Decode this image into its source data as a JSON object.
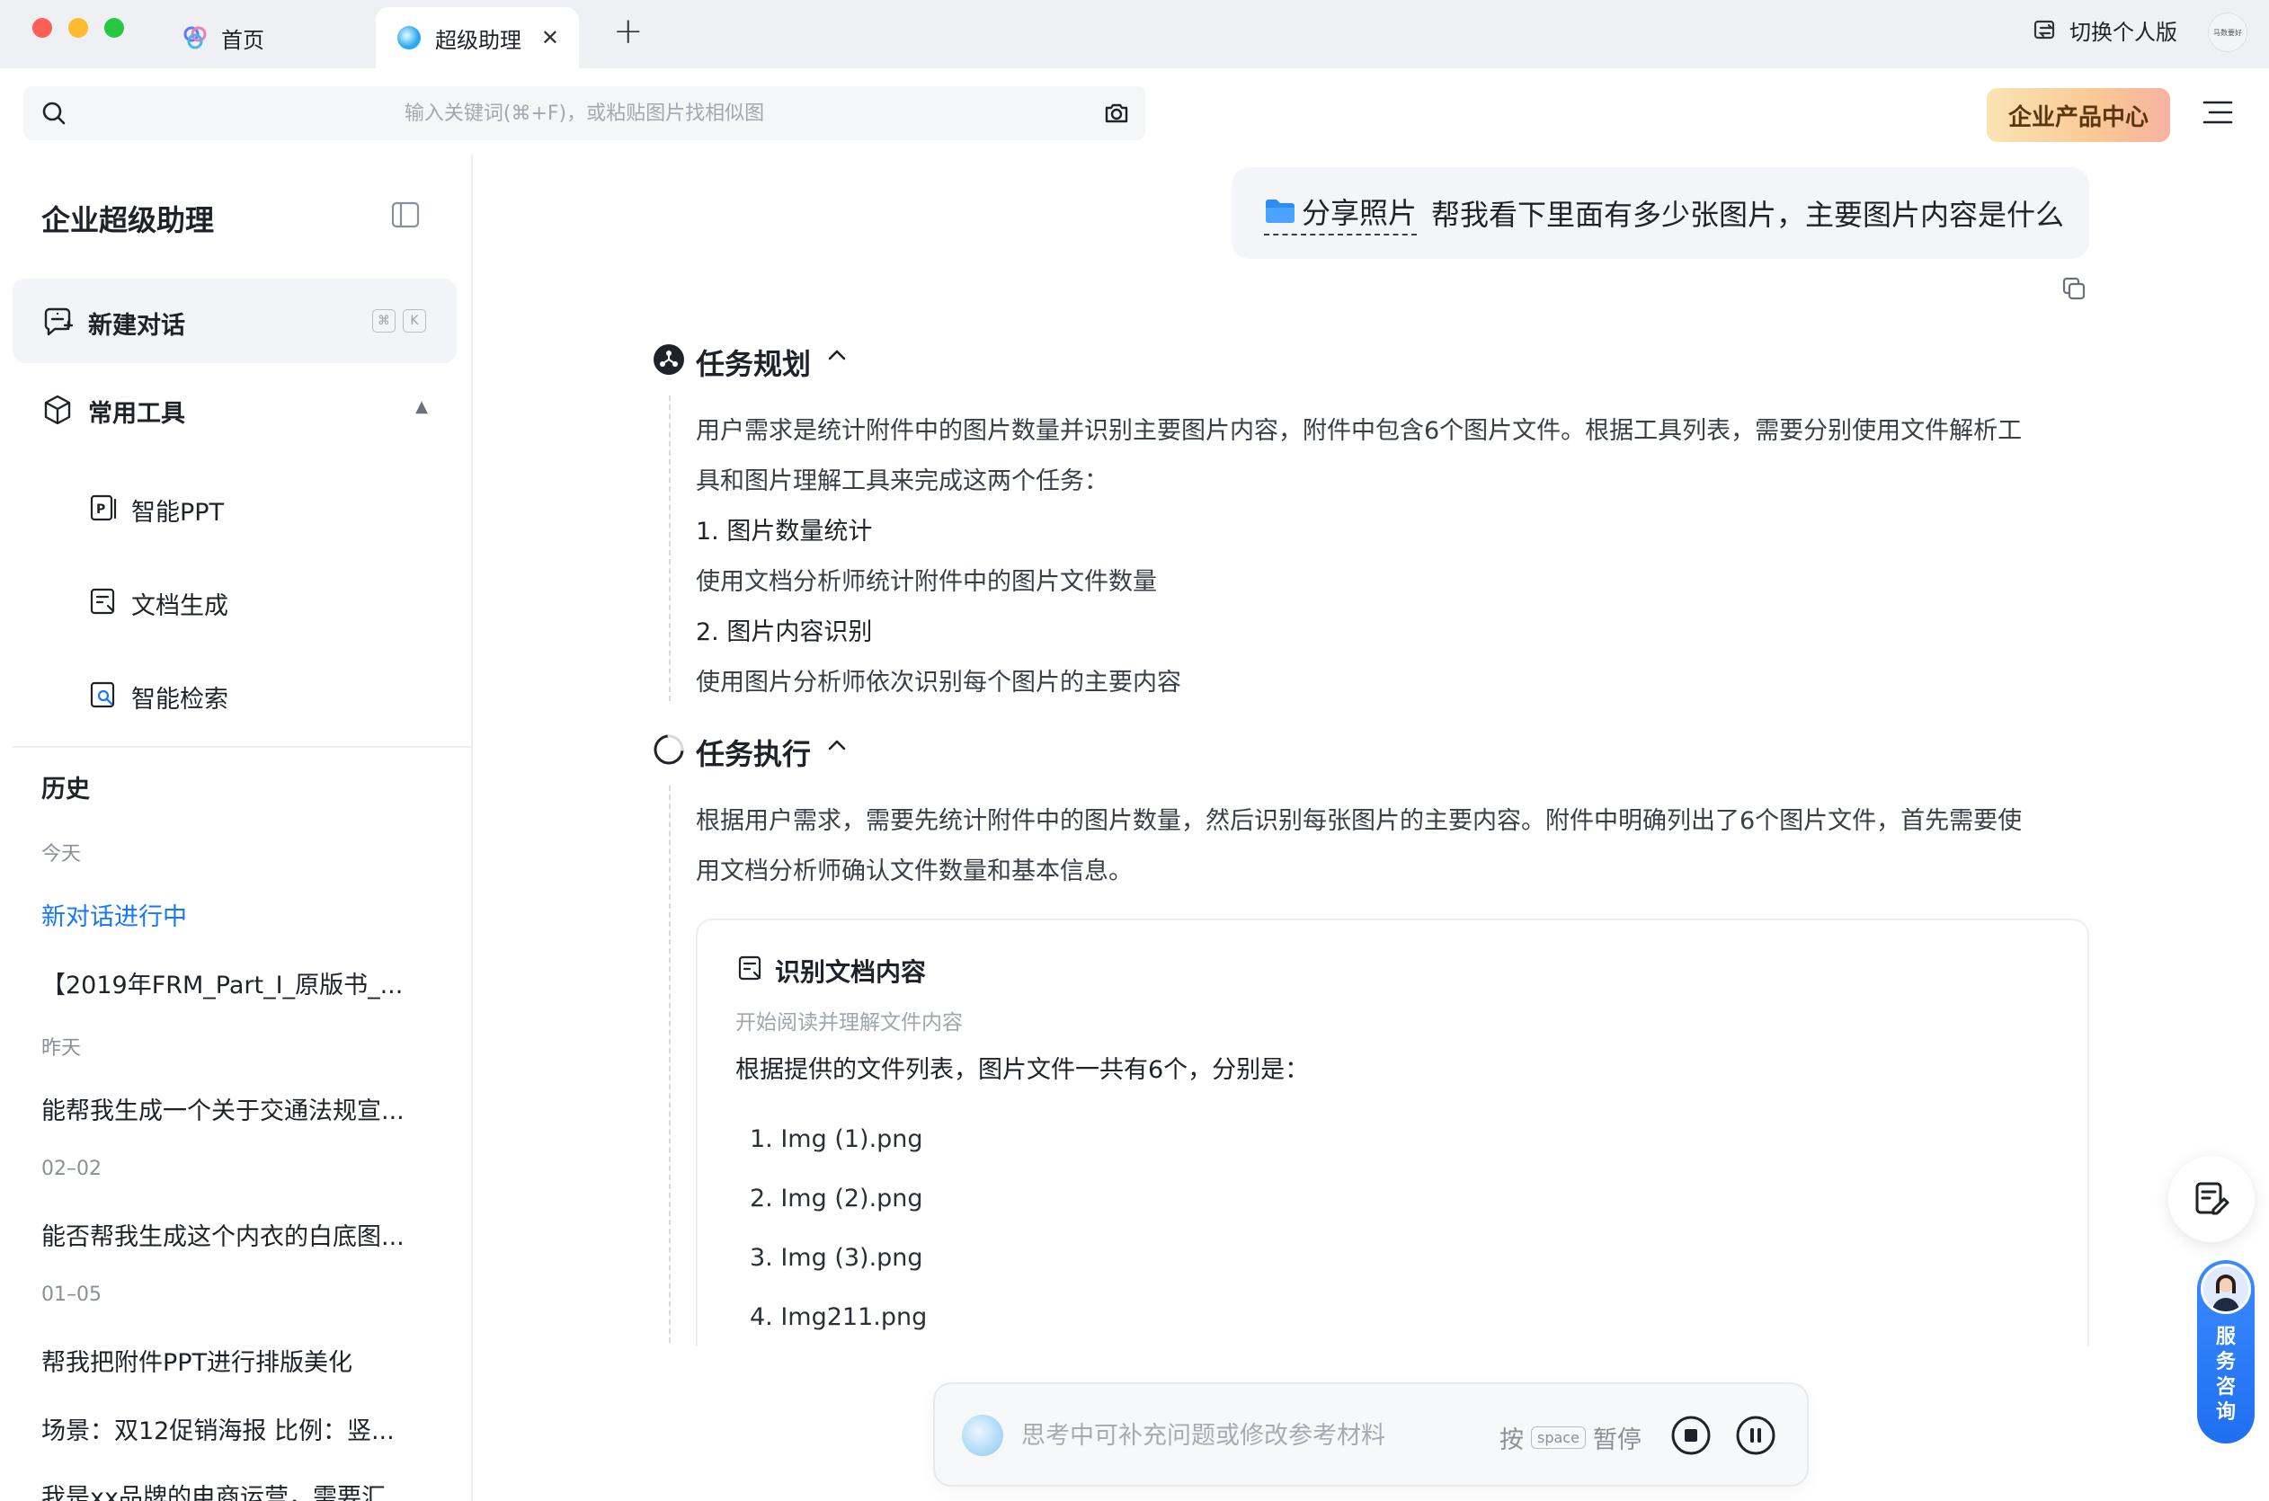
{
  "tabs": [
    {
      "label": "首页",
      "icon": "home-logo-icon"
    },
    {
      "label": "超级助理",
      "icon": "assistant-orb-icon",
      "active": true
    }
  ],
  "titlebar": {
    "switch_label": "切换个人版",
    "avatar_text": "马数要好"
  },
  "search": {
    "placeholder": "输入关键词(⌘+F)，或粘贴图片找相似图"
  },
  "toolbar": {
    "enterprise_label": "企业产品中心"
  },
  "sidebar": {
    "title": "企业超级助理",
    "new_chat_label": "新建对话",
    "shortcut_keys": [
      "⌘",
      "K"
    ],
    "tools_title": "常用工具",
    "tools": [
      {
        "label": "智能PPT",
        "icon": "ppt-icon"
      },
      {
        "label": "文档生成",
        "icon": "doc-gen-icon"
      },
      {
        "label": "智能检索",
        "icon": "search-doc-icon"
      }
    ],
    "history_title": "历史",
    "history_groups": [
      {
        "label": "今天",
        "items": [
          "新对话进行中",
          "【2019年FRM_Part_I_原版书_..."
        ]
      },
      {
        "label": "昨天",
        "items": [
          "能帮我生成一个关于交通法规宣..."
        ]
      },
      {
        "label": "02–02",
        "items": [
          "能否帮我生成这个内衣的白底图..."
        ]
      },
      {
        "label": "01–05",
        "items": [
          "帮我把附件PPT进行排版美化",
          "场景：双12促销海报 比例：竖...",
          "我是xx品牌的电商运营，需要汇..."
        ]
      }
    ]
  },
  "chat": {
    "user_message": {
      "attachment_label": "分享照片",
      "text": "帮我看下里面有多少张图片，主要图片内容是什么"
    },
    "planning": {
      "title": "任务规划",
      "lines": [
        "用户需求是统计附件中的图片数量并识别主要图片内容，附件中包含6个图片文件。根据工具列表，需要分别使用文件解析工",
        "具和图片理解工具来完成这两个任务：",
        "1. 图片数量统计",
        "使用文档分析师统计附件中的图片文件数量",
        "2. 图片内容识别",
        "使用图片分析师依次识别每个图片的主要内容"
      ]
    },
    "execution": {
      "title": "任务执行",
      "lines": [
        "根据用户需求，需要先统计附件中的图片数量，然后识别每张图片的主要内容。附件中明确列出了6个图片文件，首先需要使",
        "用文档分析师确认文件数量和基本信息。"
      ],
      "card": {
        "title": "识别文档内容",
        "subtitle": "开始阅读并理解文件内容",
        "text": "根据提供的文件列表，图片文件一共有6个，分别是：",
        "files": [
          "1. Img (1).png",
          "2. Img (2).png",
          "3. Img (3).png",
          "4. Img211.png"
        ]
      }
    }
  },
  "bottom": {
    "placeholder": "思考中可补充问题或修改参考材料",
    "hint_prefix": "按",
    "hint_key": "space",
    "hint_suffix": "暂停"
  },
  "floating": {
    "service_label": "服务咨询"
  },
  "colors": {
    "accent": "#1677ff",
    "enterprise_gradient_start": "#fbe3b4",
    "enterprise_gradient_end": "#f6b3a0",
    "service_blue": "#1f6ff2"
  }
}
